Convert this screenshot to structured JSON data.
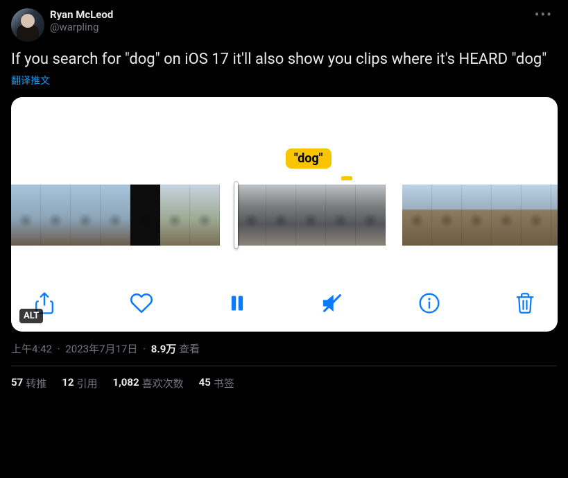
{
  "user": {
    "display_name": "Ryan McLeod",
    "handle": "@warpling"
  },
  "text": "If you search for \"dog\" on iOS 17 it'll also show you clips where it's HEARD \"dog\"",
  "translate_label": "翻译推文",
  "media": {
    "search_term": "\"dog\"",
    "alt_badge": "ALT"
  },
  "meta": {
    "time": "上午4:42",
    "date": "2023年7月17日",
    "views_count": "8.9万",
    "views_label": "查看"
  },
  "stats": {
    "retweets": {
      "count": "57",
      "label": "转推"
    },
    "quotes": {
      "count": "12",
      "label": "引用"
    },
    "likes": {
      "count": "1,082",
      "label": "喜欢次数"
    },
    "bookmarks": {
      "count": "45",
      "label": "书签"
    }
  }
}
